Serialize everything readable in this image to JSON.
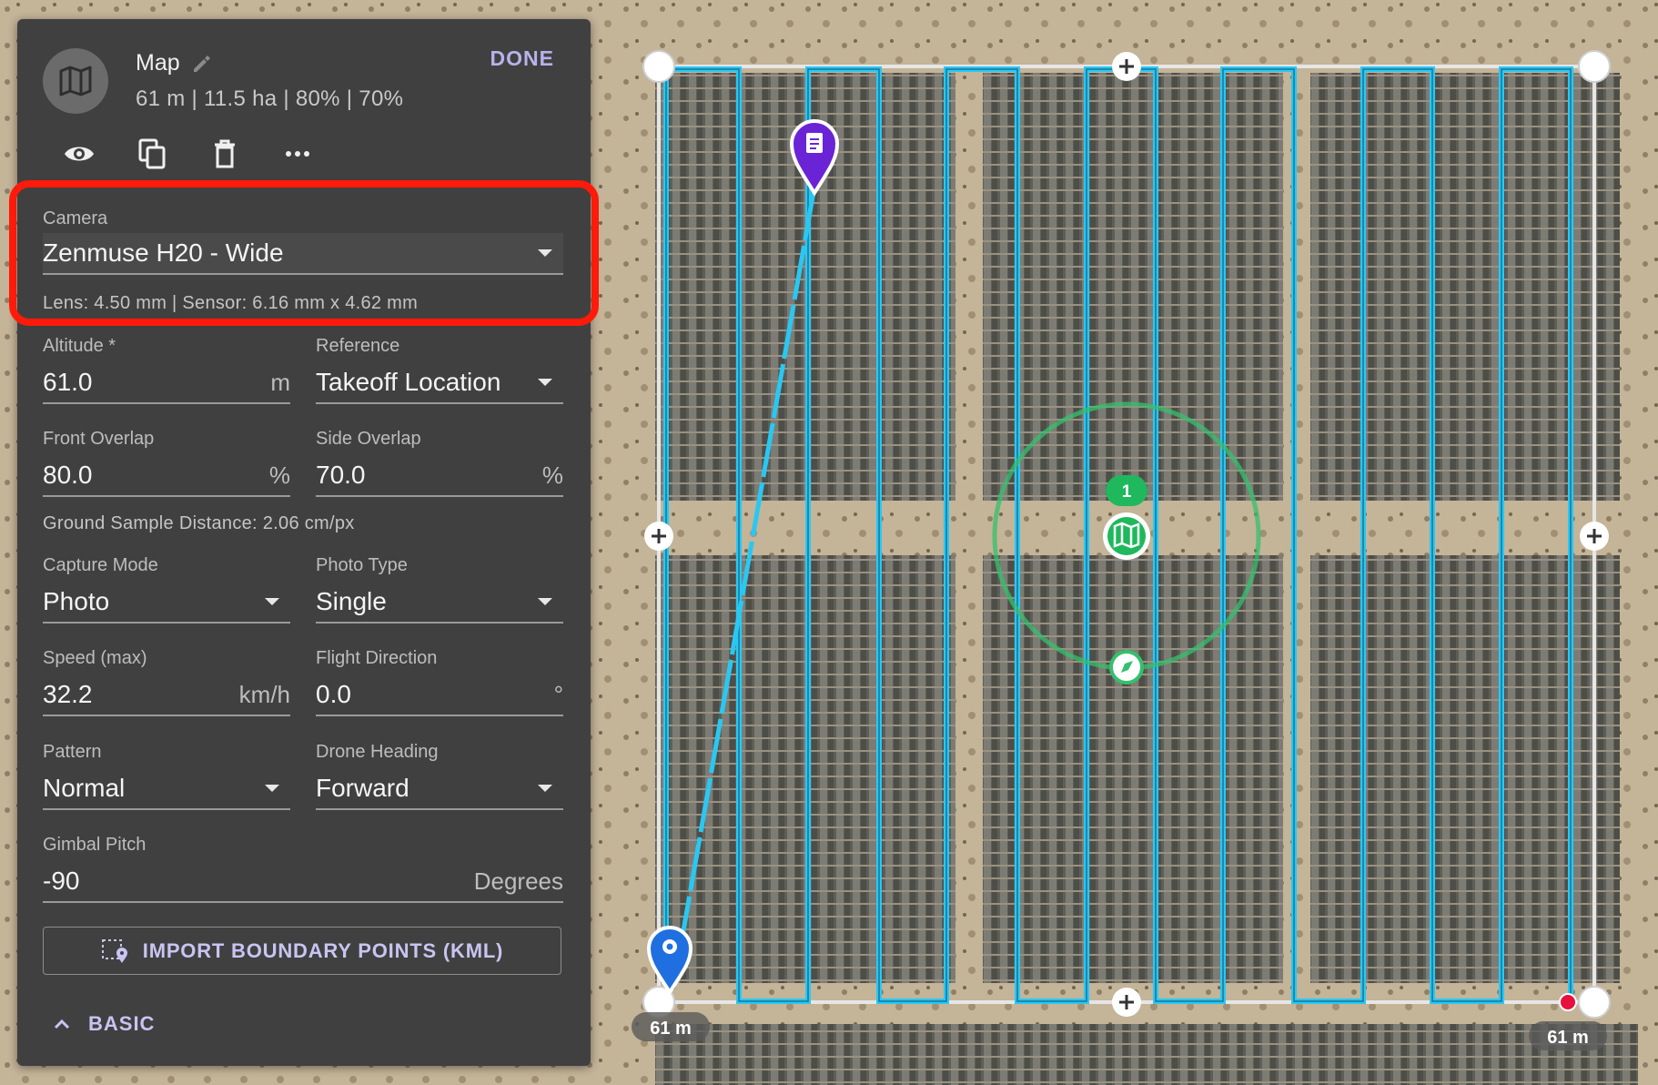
{
  "mission": {
    "title": "Map",
    "summary": "61 m | 11.5 ha | 80% | 70%",
    "done_label": "DONE"
  },
  "actions": [
    "eye-icon",
    "copy-icon",
    "trash-icon",
    "more-icon"
  ],
  "camera": {
    "label": "Camera",
    "value": "Zenmuse H20 - Wide",
    "specs": "Lens: 4.50 mm | Sensor: 6.16 mm x 4.62 mm"
  },
  "fields": {
    "altitude": {
      "label": "Altitude *",
      "value": "61.0",
      "unit": "m"
    },
    "reference": {
      "label": "Reference",
      "value": "Takeoff Location"
    },
    "front_overlap": {
      "label": "Front Overlap",
      "value": "80.0",
      "unit": "%"
    },
    "side_overlap": {
      "label": "Side Overlap",
      "value": "70.0",
      "unit": "%"
    },
    "gsd": "Ground Sample Distance: 2.06 cm/px",
    "capture_mode": {
      "label": "Capture Mode",
      "value": "Photo"
    },
    "photo_type": {
      "label": "Photo Type",
      "value": "Single"
    },
    "speed": {
      "label": "Speed (max)",
      "value": "32.2",
      "unit": "km/h"
    },
    "flight_direction": {
      "label": "Flight Direction",
      "value": "0.0",
      "unit": "°"
    },
    "pattern": {
      "label": "Pattern",
      "value": "Normal"
    },
    "drone_heading": {
      "label": "Drone Heading",
      "value": "Forward"
    },
    "gimbal_pitch": {
      "label": "Gimbal Pitch",
      "value": "-90",
      "unit": "Degrees"
    }
  },
  "import_button": "IMPORT BOUNDARY POINTS (KML)",
  "basic_toggle": "BASIC",
  "map": {
    "route_color": "#29c8f3",
    "boundary_color": "#e6e6e6",
    "waypoint_badge": "1",
    "scale_left": "61 m",
    "scale_right": "61 m",
    "highlight_color": "#ff1a0a"
  }
}
